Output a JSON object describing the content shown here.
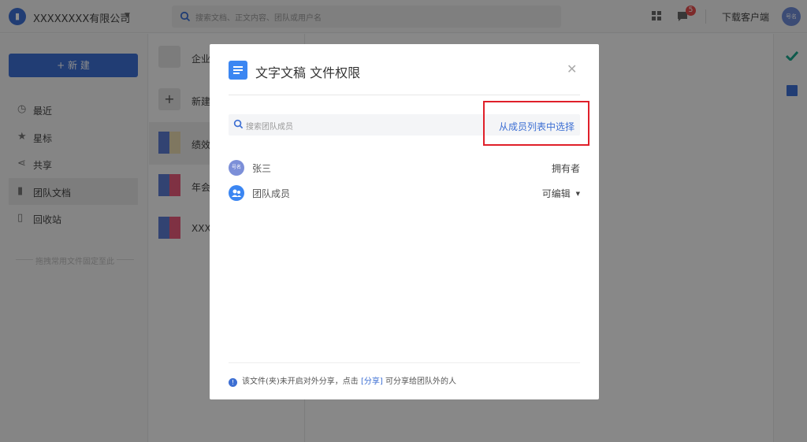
{
  "header": {
    "company_name": "XXXXXXXX有限公司",
    "search_placeholder": "搜索文档、正文内容、团队或用户名",
    "notification_count": "5",
    "download_client": "下载客户端",
    "avatar_text": "号名"
  },
  "sidebar": {
    "new_button": "+ 新 建",
    "items": [
      {
        "label": "最近",
        "icon": "clock-icon"
      },
      {
        "label": "星标",
        "icon": "star-icon"
      },
      {
        "label": "共享",
        "icon": "share-icon"
      },
      {
        "label": "团队文档",
        "icon": "team-docs-icon"
      },
      {
        "label": "回收站",
        "icon": "trash-icon"
      }
    ],
    "pin_hint": "拖拽常用文件固定至此"
  },
  "filelist": {
    "items": [
      {
        "label": "企业"
      },
      {
        "label": "新建"
      },
      {
        "label": "绩效"
      },
      {
        "label": "年会"
      },
      {
        "label": "XXX"
      }
    ]
  },
  "modal": {
    "title": "文字文稿 文件权限",
    "search_placeholder": "搜索团队成员",
    "pick_from_list": "从成员列表中选择",
    "members": [
      {
        "name": "张三",
        "role": "拥有者",
        "avatar_text": "号名"
      },
      {
        "name": "团队成员",
        "role": "可编辑",
        "has_dropdown": true
      }
    ],
    "footer_notice_pre": "该文件(夹)未开启对外分享，点击",
    "footer_notice_link": "[分享]",
    "footer_notice_post": "可分享给团队外的人"
  },
  "colors": {
    "accent": "#3d6fd3",
    "highlight_box": "#e0202a"
  }
}
